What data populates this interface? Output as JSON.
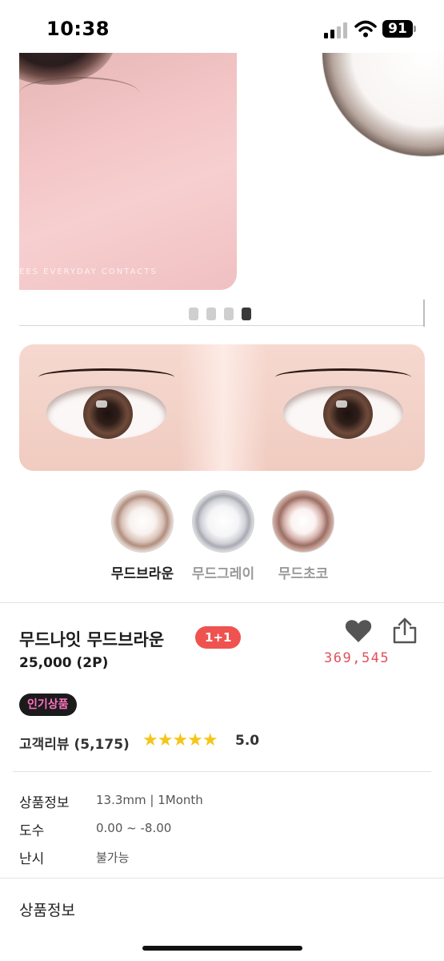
{
  "status_bar": {
    "time": "10:38",
    "battery": "91"
  },
  "carousel": {
    "watermark": "EES EVERYDAY CONTACTS",
    "slide_count": 4,
    "active_slide": 4
  },
  "colors": {
    "promo_red": "#ef5350",
    "like_red": "#e0525a",
    "star_yellow": "#f5c518",
    "hot_badge_bg": "#1b1b1b",
    "hot_badge_text": "#ff72c2"
  },
  "swatches": [
    {
      "label": "무드브라운",
      "selected": true
    },
    {
      "label": "무드그레이",
      "selected": false
    },
    {
      "label": "무드초코",
      "selected": false
    }
  ],
  "product": {
    "title": "무드나잇 무드브라운",
    "promo_badge": "1+1",
    "price": "25,000 (2P)",
    "like_count": "369,545",
    "hot_badge": "인기상품",
    "review_label": "고객리뷰 (5,175)",
    "stars": "★★★★★",
    "rating": "5.0",
    "icons": {
      "like": "heart-icon",
      "share": "share-icon"
    }
  },
  "specs": [
    {
      "label": "상품정보",
      "value": "13.3mm | 1Month"
    },
    {
      "label": "도수",
      "value": "0.00 ~ -8.00"
    },
    {
      "label": "난시",
      "value": "불가능"
    }
  ],
  "section": {
    "bottom_title": "상품정보"
  }
}
